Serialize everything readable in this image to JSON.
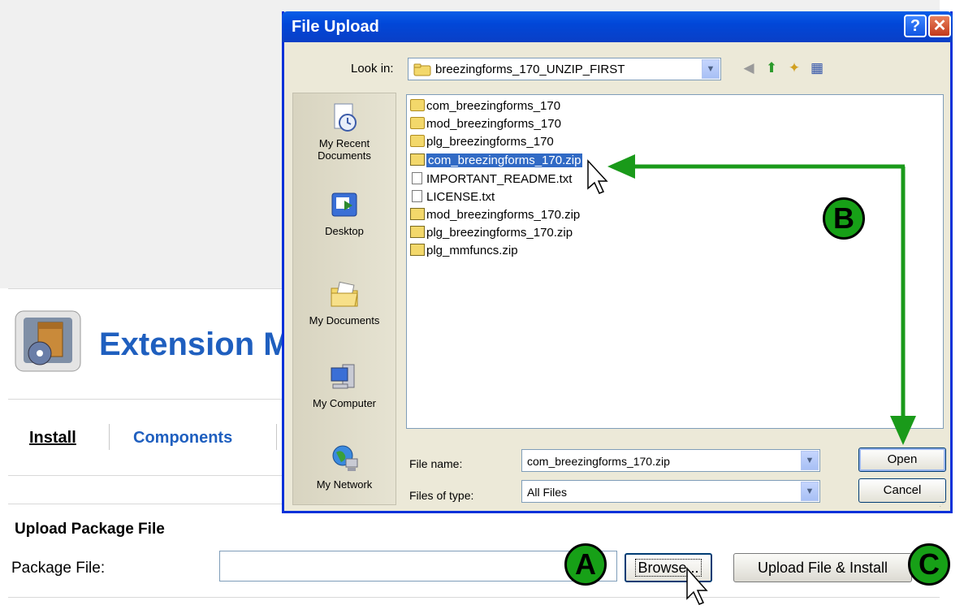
{
  "page": {
    "title": "Extension M",
    "tabs": [
      {
        "label": "Install"
      },
      {
        "label": "Components"
      }
    ],
    "upload_heading": "Upload Package File",
    "package_label": "Package File:",
    "browse_label": "Browse...",
    "upload_label": "Upload File & Install"
  },
  "dialog": {
    "title": "File Upload",
    "help_symbol": "?",
    "close_symbol": "✕",
    "look_in_label": "Look in:",
    "look_in_value": "breezingforms_170_UNZIP_FIRST",
    "places": [
      {
        "label": "My Recent\nDocuments"
      },
      {
        "label": "Desktop"
      },
      {
        "label": "My Documents"
      },
      {
        "label": "My Computer"
      },
      {
        "label": "My Network"
      }
    ],
    "files": [
      {
        "name": "com_breezingforms_170",
        "type": "folder"
      },
      {
        "name": "mod_breezingforms_170",
        "type": "folder"
      },
      {
        "name": "plg_breezingforms_170",
        "type": "folder"
      },
      {
        "name": "com_breezingforms_170.zip",
        "type": "zip",
        "selected": true
      },
      {
        "name": "IMPORTANT_README.txt",
        "type": "txt"
      },
      {
        "name": "LICENSE.txt",
        "type": "txt"
      },
      {
        "name": "mod_breezingforms_170.zip",
        "type": "zip"
      },
      {
        "name": "plg_breezingforms_170.zip",
        "type": "zip"
      },
      {
        "name": "plg_mmfuncs.zip",
        "type": "zip"
      }
    ],
    "file_name_label": "File name:",
    "file_name_value": "com_breezingforms_170.zip",
    "files_of_type_label": "Files of type:",
    "files_of_type_value": "All Files",
    "open_label": "Open",
    "cancel_label": "Cancel"
  },
  "annotations": {
    "badges": [
      "A",
      "B",
      "C"
    ],
    "arrow_color": "#1a9a1a",
    "badge_color": "#17a017"
  },
  "colors": {
    "title_blue": "#1f5fbf",
    "xp_titlebar": "#0147d8",
    "selection": "#316ac5"
  }
}
